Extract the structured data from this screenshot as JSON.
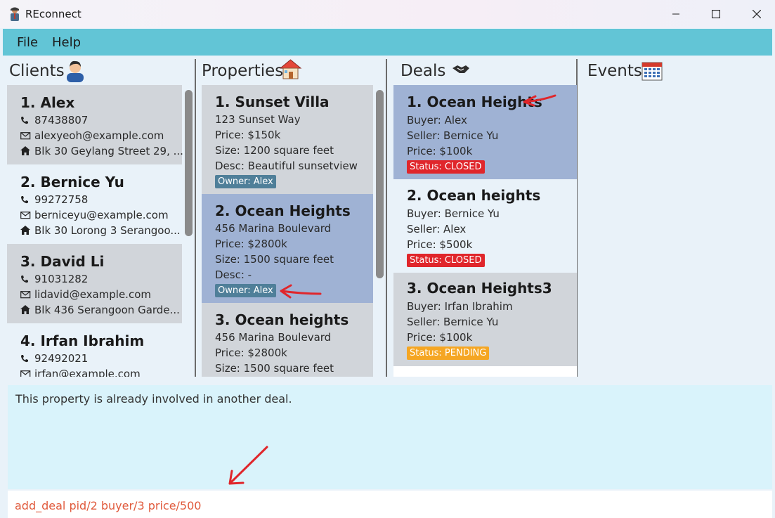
{
  "window": {
    "title": "REconnect"
  },
  "menu": {
    "file": "File",
    "help": "Help"
  },
  "panels": {
    "clients": "Clients",
    "properties": "Properties",
    "deals": "Deals",
    "events": "Events"
  },
  "clients": [
    {
      "title": "1. Alex",
      "phone": "87438807",
      "email": "alexyeoh@example.com",
      "address": "Blk 30 Geylang Street 29, ..."
    },
    {
      "title": "2. Bernice Yu",
      "phone": "99272758",
      "email": "berniceyu@example.com",
      "address": "Blk 30 Lorong 3 Serangoo..."
    },
    {
      "title": "3. David Li",
      "phone": "91031282",
      "email": "lidavid@example.com",
      "address": "Blk 436 Serangoon Garde..."
    },
    {
      "title": "4. Irfan Ibrahim",
      "phone": "92492021",
      "email": "irfan@example.com",
      "address": ""
    }
  ],
  "properties": [
    {
      "title": "1. Sunset Villa",
      "address": "123 Sunset Way",
      "price": "Price: $150k",
      "size": "Size: 1200 square feet",
      "desc": "Desc: Beautiful sunsetview",
      "owner": "Owner: Alex"
    },
    {
      "title": "2. Ocean Heights",
      "address": "456 Marina Boulevard",
      "price": "Price: $2800k",
      "size": "Size: 1500 square feet",
      "desc": "Desc: -",
      "owner": "Owner: Alex"
    },
    {
      "title": "3. Ocean heights",
      "address": "456 Marina Boulevard",
      "price": "Price: $2800k",
      "size": "Size: 1500 square feet"
    }
  ],
  "deals": [
    {
      "title": "1. Ocean Heights",
      "buyer": "Buyer: Alex",
      "seller": "Seller: Bernice Yu",
      "price": "Price: $100k",
      "status": "Status: CLOSED"
    },
    {
      "title": "2. Ocean heights",
      "buyer": "Buyer: Bernice Yu",
      "seller": "Seller: Alex",
      "price": "Price: $500k",
      "status": "Status: CLOSED"
    },
    {
      "title": "3. Ocean Heights3",
      "buyer": "Buyer: Irfan Ibrahim",
      "seller": "Seller: Bernice Yu",
      "price": "Price: $100k",
      "status": "Status: PENDING"
    }
  ],
  "result_text": "This property is already involved in another deal.",
  "command": {
    "value": "add_deal pid/2 buyer/3 price/500"
  },
  "colors": {
    "menubar": "#62c5d6",
    "selected_card": "#9fb2d4",
    "grey_card": "#d1d5da",
    "owner_tag": "#4f7f99",
    "closed": "#e0262b",
    "pending": "#f5a623",
    "annotation_arrow": "#e0262b",
    "command_text": "#e05a3c"
  },
  "icons": {
    "app": "realtor-icon",
    "clients": "person-icon",
    "properties": "house-icon",
    "deals": "handshake-icon",
    "events": "calendar-icon"
  }
}
